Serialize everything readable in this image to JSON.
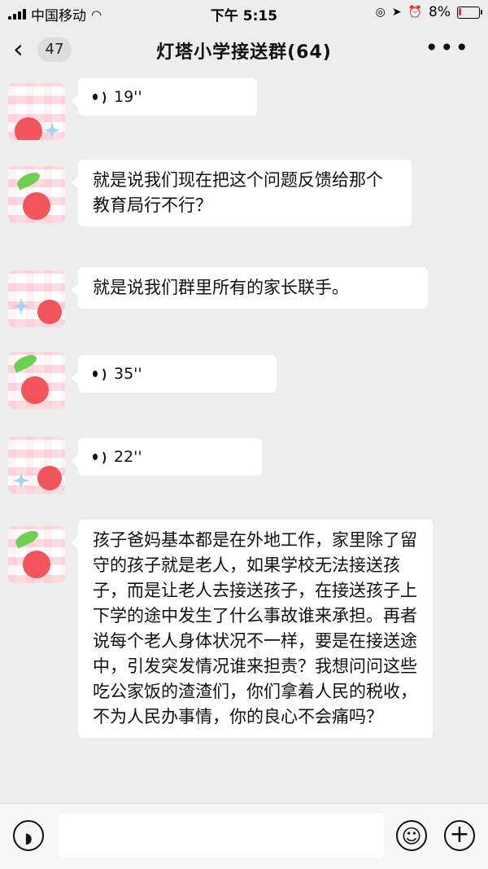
{
  "status_bar": {
    "carrier": "中国移动",
    "time": "下午 5:15",
    "battery": "8%"
  },
  "nav": {
    "back_count": "47",
    "title": "灯塔小学接送群(64)",
    "more_label": "•••"
  },
  "messages": [
    {
      "type": "voice",
      "duration": "19''"
    },
    {
      "type": "text",
      "text": "就是说我们现在把这个问题反馈给那个教育局行不行？"
    },
    {
      "type": "text",
      "text": "就是说我们群里所有的家长联手。"
    },
    {
      "type": "voice",
      "duration": "35''"
    },
    {
      "type": "voice",
      "duration": "22''"
    },
    {
      "type": "text",
      "text": "孩子爸妈基本都是在外地工作，家里除了留守的孩子就是老人，如果学校无法接送孩子，而是让老人去接送孩子，在接送孩子上下学的途中发生了什么事故谁来承担。再者说每个老人身体状况不一样，要是在接送途中，引发突发情况谁来担责？我想问问这些吃公家饭的渣渣们，你们拿着人民的税收，不为人民办事情，你的良心不会痛吗？"
    }
  ],
  "input_bar": {
    "emoji_icon": "smiley-face-icon",
    "plus_label": "+",
    "input_value": ""
  },
  "colors": {
    "background": "#ededed",
    "bubble": "#ffffff",
    "avatar_cherry": "#f2545b"
  }
}
